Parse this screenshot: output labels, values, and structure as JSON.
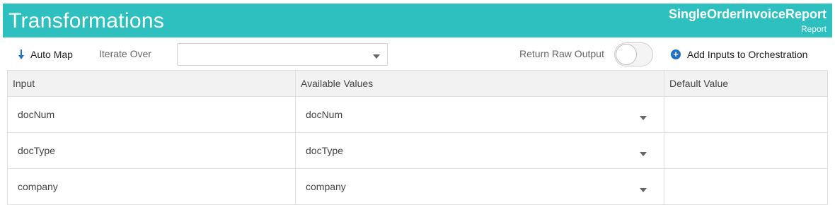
{
  "header": {
    "title": "Transformations",
    "object_name": "SingleOrderInvoiceReport",
    "object_type": "Report",
    "background_color": "#2ebfbf"
  },
  "toolbar": {
    "auto_map_label": "Auto Map",
    "auto_map_icon": "arrow-down-icon",
    "iterate_over_label": "Iterate Over",
    "iterate_over_value": "",
    "return_raw_output_label": "Return Raw Output",
    "return_raw_output_on": false,
    "add_inputs_label": "Add Inputs to Orchestration",
    "add_inputs_icon": "plus-circle-icon",
    "accent_color": "#1f6fc5"
  },
  "table": {
    "columns": [
      "Input",
      "Available Values",
      "Default Value"
    ],
    "rows": [
      {
        "input": "docNum",
        "available_value": "docNum",
        "default_value": ""
      },
      {
        "input": "docType",
        "available_value": "docType",
        "default_value": ""
      },
      {
        "input": "company",
        "available_value": "company",
        "default_value": ""
      }
    ]
  }
}
